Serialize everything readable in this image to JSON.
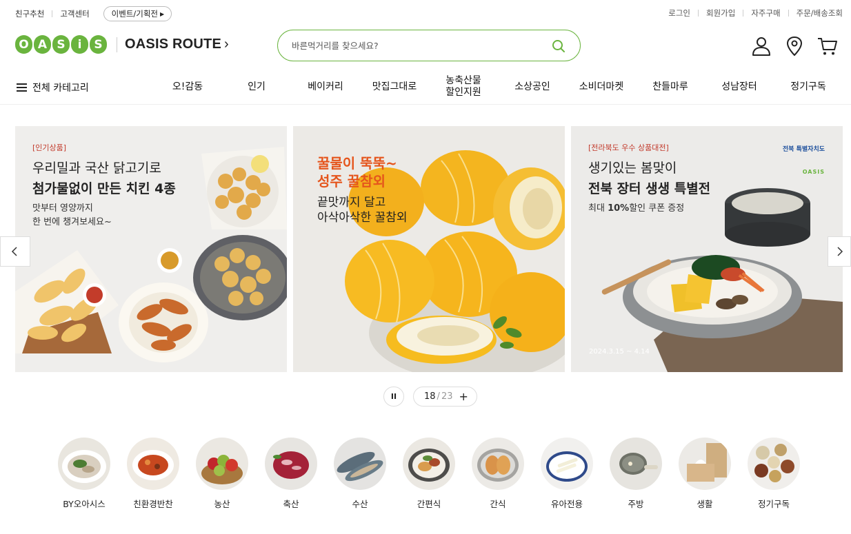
{
  "topbar": {
    "links_left": [
      "친구추천",
      "고객센터"
    ],
    "event_label": "이벤트/기획전",
    "links_right": [
      "로그인",
      "회원가입",
      "자주구매",
      "주문/배송조회"
    ]
  },
  "header": {
    "logo_letters": [
      "O",
      "A",
      "S",
      "i",
      "S"
    ],
    "route_label": "OASIS ROUTE",
    "search_placeholder": "바른먹거리를 찾으세요?"
  },
  "nav": {
    "all_category": "전체 카테고리",
    "items": [
      "오!감동",
      "인기",
      "베이커리",
      "맛집그대로",
      "농축산물\n할인지원",
      "소상공인",
      "소비더마켓",
      "찬들마루",
      "성남장터",
      "정기구독"
    ]
  },
  "banners": [
    {
      "tag": "[인기상품]",
      "title_line1": "우리밀과 국산 닭고기로",
      "title_line2": "첨가물없이 만든 치킨 4종",
      "sub": [
        "맛부터 영양까지",
        "한 번에 챙겨보세요~"
      ]
    },
    {
      "title_line1": "꿀물이 뚝뚝~",
      "title_line2": "성주 꿀참외",
      "sub": [
        "끝맛까지 달고",
        "아삭아삭한 꿀참외"
      ]
    },
    {
      "tag": "[전라북도 우수 상품대전]",
      "title_line1": "생기있는 봄맞이",
      "title_line2": "전북 장터 생생 특별전",
      "sub_pre": "최대 ",
      "sub_bold": "10%",
      "sub_post": "할인 쿠폰 증정",
      "sponsor": "전북 특별자치도",
      "sponsor_logo": "OASIS",
      "date": "2024.3.15 ~ 4.14"
    }
  ],
  "pager": {
    "current": "18",
    "separator": "/",
    "total": "23",
    "plus": "+",
    "pause": "II"
  },
  "categories": [
    "BY오아시스",
    "친환경반찬",
    "농산",
    "축산",
    "수산",
    "간편식",
    "간식",
    "유아전용",
    "주방",
    "생활",
    "정기구독"
  ],
  "colors": {
    "brand_green": "#6ab43e",
    "tag_red": "#c23a2b",
    "melon_title": "#e5551c"
  }
}
